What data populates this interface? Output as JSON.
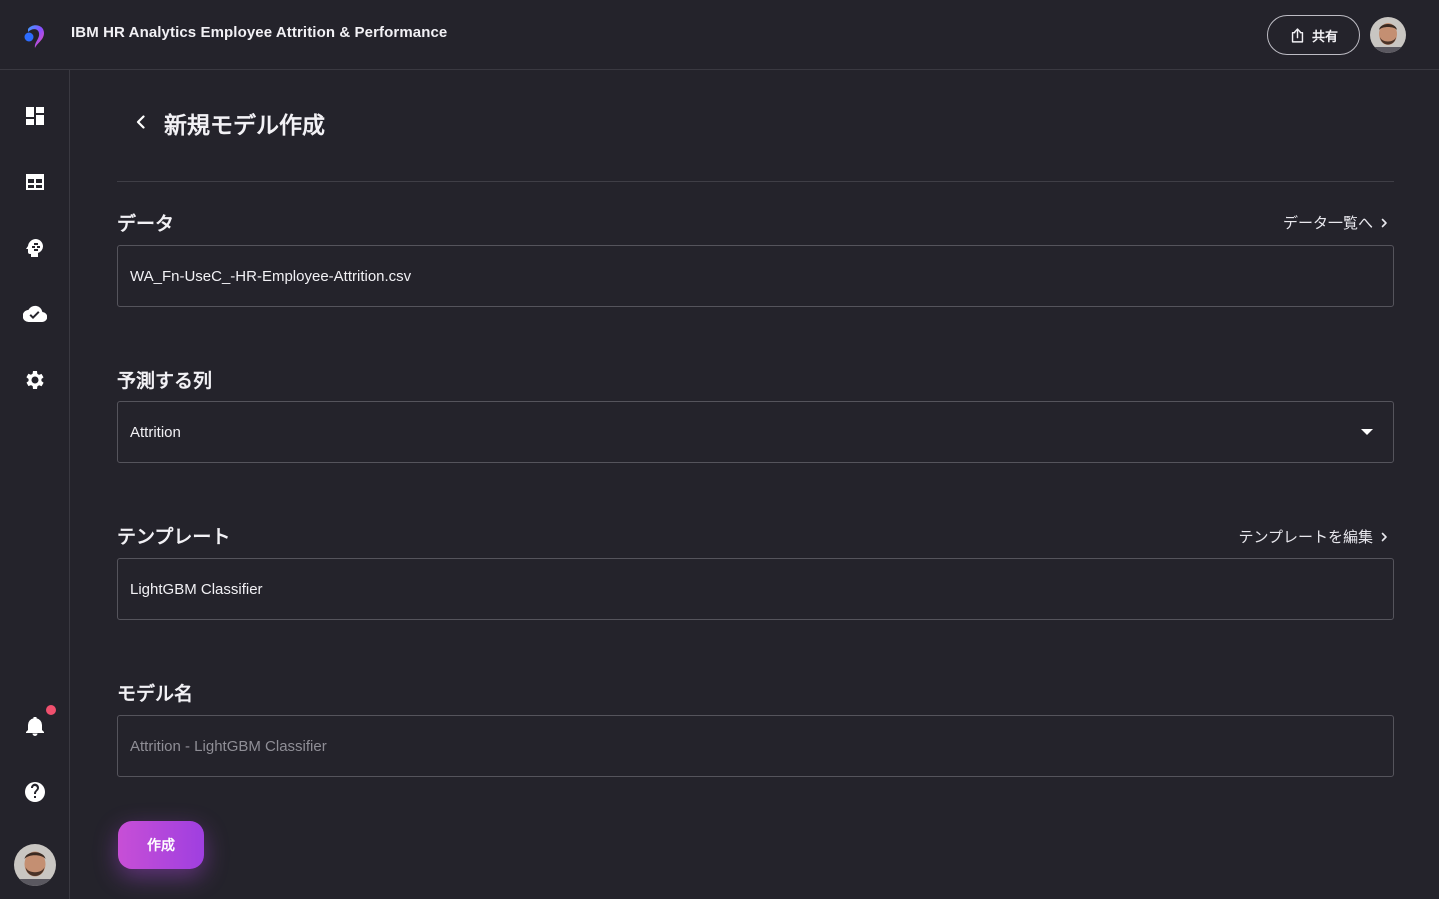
{
  "header": {
    "app_title": "IBM HR Analytics Employee Attrition & Performance",
    "share_label": "共有"
  },
  "sidebar": {
    "items": [
      {
        "icon": "dashboard-icon"
      },
      {
        "icon": "table-icon"
      },
      {
        "icon": "brain-icon"
      },
      {
        "icon": "cloud-check-icon"
      },
      {
        "icon": "gear-icon"
      }
    ],
    "bottom": [
      {
        "icon": "bell-icon",
        "has_notification": true
      },
      {
        "icon": "help-icon"
      }
    ]
  },
  "page": {
    "title": "新規モデル作成"
  },
  "form": {
    "data": {
      "label": "データ",
      "link": "データ一覧へ",
      "value": "WA_Fn-UseC_-HR-Employee-Attrition.csv"
    },
    "target": {
      "label": "予測する列",
      "value": "Attrition"
    },
    "template": {
      "label": "テンプレート",
      "link": "テンプレートを編集",
      "value": "LightGBM Classifier"
    },
    "model_name": {
      "label": "モデル名",
      "placeholder": "Attrition - LightGBM Classifier"
    },
    "submit_label": "作成"
  },
  "colors": {
    "background": "#24232b",
    "accent_start": "#c74fd6",
    "accent_end": "#9f3fe0",
    "notification": "#f0506e"
  }
}
